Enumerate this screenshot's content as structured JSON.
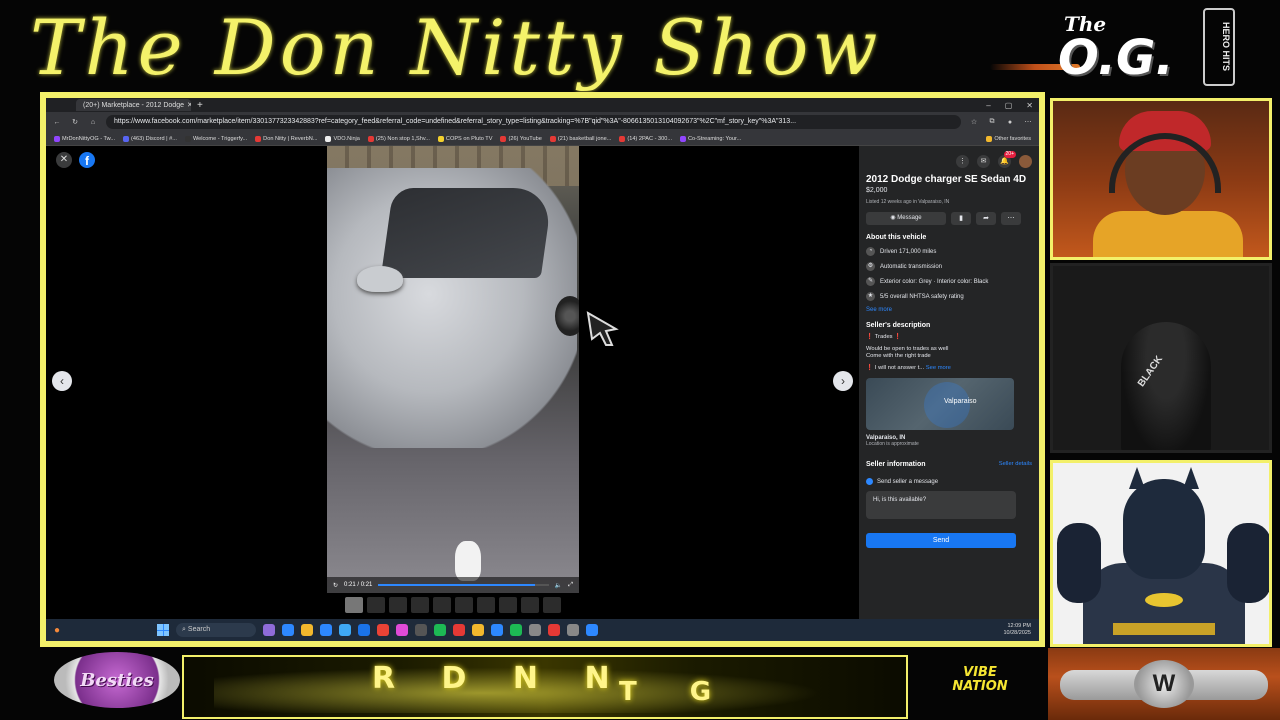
{
  "overlay": {
    "show_title": "The Don Nitty Show",
    "og_logo_top": "The",
    "og_logo_main": "O.G.",
    "side_badge": "HERO HITS",
    "besties_text": "Besties",
    "ticker_left": "R D N N",
    "ticker_right": "T G",
    "vibe_nation_main": "VIBE NATION",
    "vibe_nation_sub": "",
    "belt_logo": "W",
    "webcam_hat_text": "BLACK"
  },
  "browser": {
    "tab_title": "(20+) Marketplace - 2012 Dodge",
    "new_tab": "+",
    "window_controls": [
      "–",
      "▢",
      "✕"
    ],
    "url": "https://www.facebook.com/marketplace/item/3301377323342883?ref=category_feed&referral_code=undefined&referral_story_type=listing&tracking=%7B\"qid\"%3A\"-8066135013104092673\"%2C\"mf_story_key\"%3A\"313...",
    "bookmarks": [
      "MrDonNittyOG - Tw...",
      "(463) Discord | #...",
      "Welcome - Triggerfy...",
      "Don Nitty | ReverbN...",
      "VDO.Ninja",
      "(25) Non stop 1,Shv...",
      "COPS on Pluto TV",
      "(26) YouTube",
      "(21) basketball jone...",
      "(14) 2PAC - 300...",
      "Co-Streaming: Your..."
    ],
    "other_favorites": "Other favorites"
  },
  "viewer": {
    "close_icon": "✕",
    "facebook_logo": "f",
    "prev": "‹",
    "next": "›",
    "video_time": "0:21 / 0:21",
    "video_progress": 0.92,
    "thumbnails_count": 10,
    "active_thumbnail": 0
  },
  "listing": {
    "notification_badge": "20+",
    "title": "2012 Dodge charger SE Sedan 4D",
    "price": "$2,000",
    "listed": "Listed 12 weeks ago in Valparaiso, IN",
    "message_button": "Message",
    "about_heading": "About this vehicle",
    "details": [
      {
        "icon": "speedometer-icon",
        "text": "Driven 171,000 miles"
      },
      {
        "icon": "gear-icon",
        "text": "Automatic transmission"
      },
      {
        "icon": "paint-icon",
        "text": "Exterior color: Grey · Interior color: Black"
      },
      {
        "icon": "star-icon",
        "text": "5/5 overall NHTSA safety rating"
      }
    ],
    "see_more": "See more",
    "seller_desc_heading": "Seller's description",
    "desc_trades": "Trades",
    "desc_line1": "Would be open to trades as well",
    "desc_line2": "Come with the right trade",
    "desc_line3": "I will not answer t...",
    "desc_see_more": "See more",
    "map_label": "Valparaiso",
    "location": "Valparaiso, IN",
    "location_note": "Location is approximate",
    "seller_info_heading": "Seller information",
    "seller_details_link": "Seller details",
    "send_heading": "Send seller a message",
    "message_text": "Hi, is this available?",
    "send_button": "Send"
  },
  "taskbar": {
    "search_label": "Search",
    "time": "12:09 PM",
    "date": "10/28/2025",
    "app_colors": [
      "#8e6bd8",
      "#2d88ff",
      "#f3b82d",
      "#2d88ff",
      "#3fa9f5",
      "#1a73e8",
      "#ea4335",
      "#e04ad6",
      "#555",
      "#1db954",
      "#e53935",
      "#f3b82d",
      "#2d88ff",
      "#1db954",
      "#888",
      "#e53935",
      "#888",
      "#2d88ff"
    ]
  },
  "colors": {
    "frame_yellow": "#f3f06a",
    "facebook_blue": "#1877f2",
    "panel_dark": "#242526"
  }
}
